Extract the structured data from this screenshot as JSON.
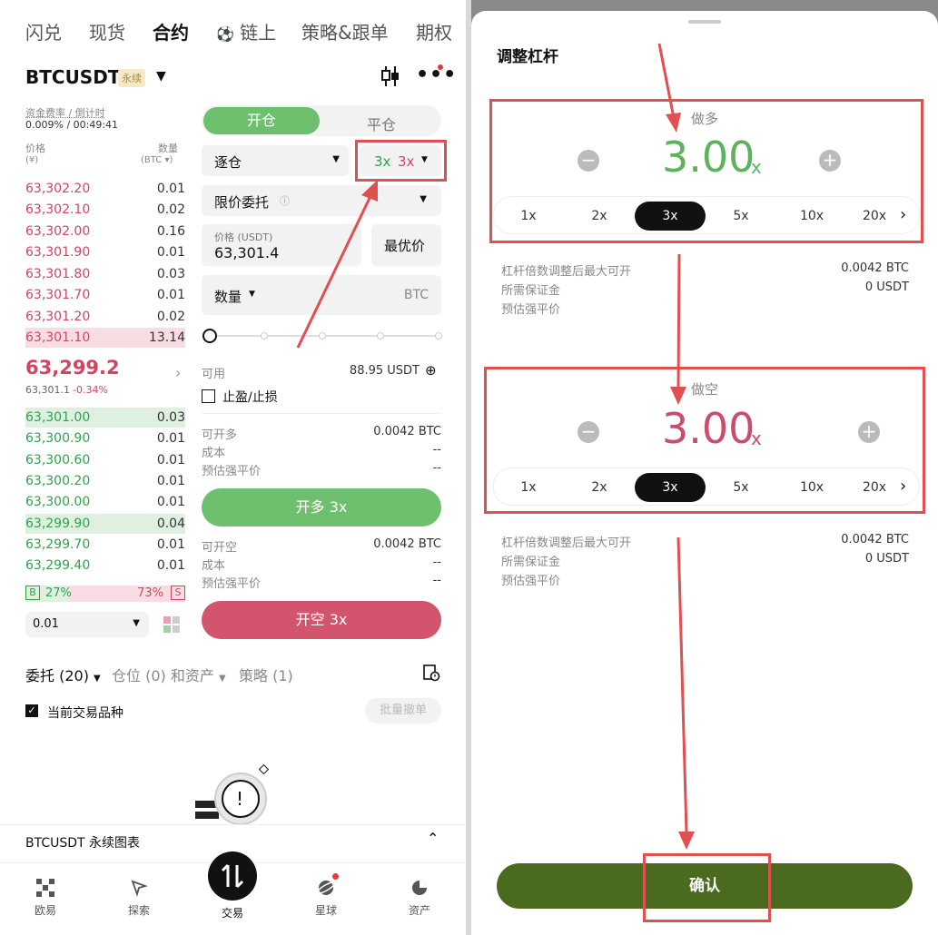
{
  "top_tabs": [
    "闪兑",
    "现货",
    "合约",
    "链上",
    "策略&跟单",
    "期权"
  ],
  "active_tab": "合约",
  "pair": "BTCUSDT",
  "pair_badge": "永续",
  "funding_label": "资金费率 / 倒计时",
  "funding_value": "0.009% / 00:49:41",
  "ob_header_price": "价格",
  "ob_header_price_unit": "(¥)",
  "ob_header_qty": "数量",
  "ob_header_qty_unit": "(BTC ▾)",
  "asks": [
    {
      "price": "63,302.20",
      "qty": "0.01"
    },
    {
      "price": "63,302.10",
      "qty": "0.02"
    },
    {
      "price": "63,302.00",
      "qty": "0.16"
    },
    {
      "price": "63,301.90",
      "qty": "0.01"
    },
    {
      "price": "63,301.80",
      "qty": "0.03"
    },
    {
      "price": "63,301.70",
      "qty": "0.01"
    },
    {
      "price": "63,301.20",
      "qty": "0.02"
    },
    {
      "price": "63,301.10",
      "qty": "13.14"
    }
  ],
  "last_price": "63,299.2",
  "last_sub": "63,301.1",
  "last_change": "-0.34%",
  "bids": [
    {
      "price": "63,301.00",
      "qty": "0.03"
    },
    {
      "price": "63,300.90",
      "qty": "0.01"
    },
    {
      "price": "63,300.60",
      "qty": "0.01"
    },
    {
      "price": "63,300.20",
      "qty": "0.01"
    },
    {
      "price": "63,300.00",
      "qty": "0.01"
    },
    {
      "price": "63,299.90",
      "qty": "0.04"
    },
    {
      "price": "63,299.70",
      "qty": "0.01"
    },
    {
      "price": "63,299.40",
      "qty": "0.01"
    }
  ],
  "buy_ratio": {
    "b": "B",
    "pct": "27%",
    "s_pct": "73%",
    "s": "S",
    "buy_fraction": 0.27
  },
  "depth_select": "0.01",
  "order_tabs": {
    "open": "开仓",
    "close": "平仓"
  },
  "margin_mode": "逐仓",
  "leverage_long": "3x",
  "leverage_short": "3x",
  "order_type": "限价委托",
  "price_label": "价格 (USDT)",
  "price_value": "63,301.4",
  "best_price": "最优价",
  "qty_label": "数量",
  "qty_unit": "BTC",
  "available_label": "可用",
  "available_value": "88.95 USDT",
  "tpsl_label": "止盈/止损",
  "long_info": {
    "max_label": "可开多",
    "max_value": "0.0042 BTC",
    "cost_label": "成本",
    "cost_value": "--",
    "liq_label": "预估强平价",
    "liq_value": "--"
  },
  "long_button": "开多 3x",
  "short_info": {
    "max_label": "可开空",
    "max_value": "0.0042 BTC",
    "cost_label": "成本",
    "cost_value": "--",
    "liq_label": "预估强平价",
    "liq_value": "--"
  },
  "short_button": "开空 3x",
  "bottom_tabs": {
    "orders": "委托 (20)",
    "positions": "仓位 (0) 和资产",
    "strategy": "策略 (1)"
  },
  "current_symbol_label": "当前交易品种",
  "batch_cancel": "批量撤单",
  "chart_bar_label": "BTCUSDT 永续图表",
  "nav": [
    "欧易",
    "探索",
    "交易",
    "星球",
    "资产"
  ],
  "sheet": {
    "title": "调整杠杆",
    "long_label": "做多",
    "long_value": "3.00",
    "short_label": "做空",
    "short_value": "3.00",
    "x_suffix": "x",
    "chips": [
      "1x",
      "2x",
      "3x",
      "5x",
      "10x",
      "20x"
    ],
    "selected_chip": "3x",
    "info_long": {
      "max_label": "杠杆倍数调整后最大可开",
      "max_value": "0.0042 BTC",
      "margin_label": "所需保证金",
      "margin_value": "0 USDT",
      "liq_label": "预估强平价"
    },
    "info_short": {
      "max_label": "杠杆倍数调整后最大可开",
      "max_value": "0.0042 BTC",
      "margin_label": "所需保证金",
      "margin_value": "0 USDT",
      "liq_label": "预估强平价"
    },
    "confirm": "确认"
  },
  "colors": {
    "green": "#2ea34a",
    "red": "#d2455f",
    "confirm_bg": "#4a6b1f",
    "annotation": "#e05050"
  }
}
